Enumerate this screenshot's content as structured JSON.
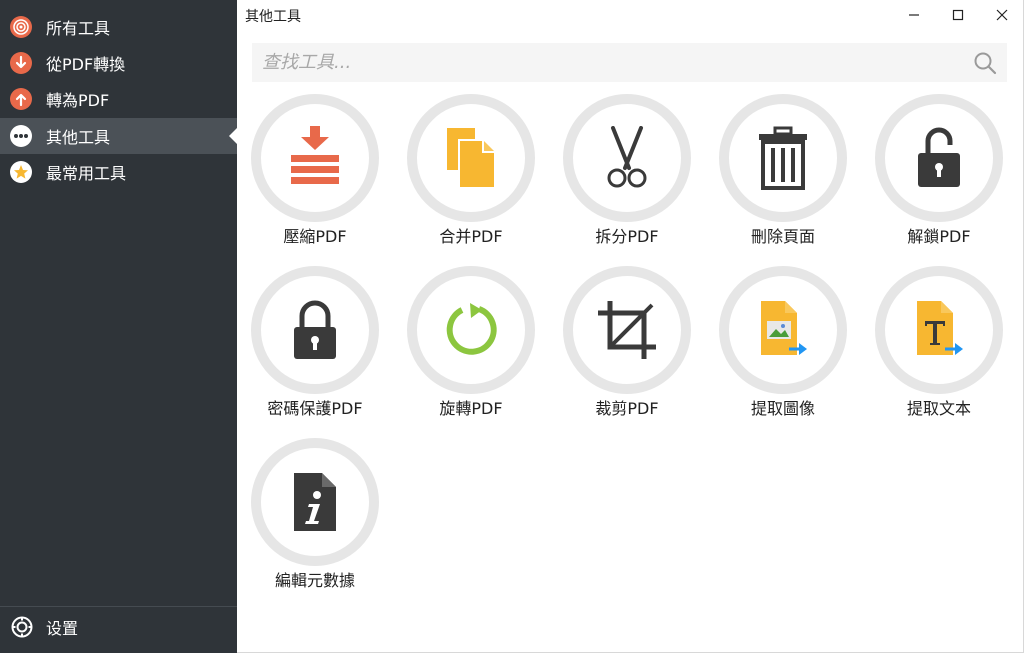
{
  "sidebar": {
    "items": [
      {
        "label": "所有工具",
        "icon": "all-tools-icon"
      },
      {
        "label": "從PDF轉換",
        "icon": "convert-from-pdf-icon"
      },
      {
        "label": "轉為PDF",
        "icon": "convert-to-pdf-icon"
      },
      {
        "label": "其他工具",
        "icon": "more-tools-icon",
        "active": true
      },
      {
        "label": "最常用工具",
        "icon": "star-icon"
      }
    ],
    "settings_label": "设置"
  },
  "window": {
    "title": "其他工具",
    "controls": [
      "minimize",
      "maximize",
      "close"
    ]
  },
  "search": {
    "placeholder": "查找工具..."
  },
  "tools": [
    {
      "label": "壓縮PDF",
      "icon": "compress-icon"
    },
    {
      "label": "合并PDF",
      "icon": "merge-icon"
    },
    {
      "label": "拆分PDF",
      "icon": "scissors-icon"
    },
    {
      "label": "刪除頁面",
      "icon": "trash-icon"
    },
    {
      "label": "解鎖PDF",
      "icon": "unlock-icon"
    },
    {
      "label": "密碼保護PDF",
      "icon": "lock-icon"
    },
    {
      "label": "旋轉PDF",
      "icon": "rotate-icon"
    },
    {
      "label": "裁剪PDF",
      "icon": "crop-icon"
    },
    {
      "label": "提取圖像",
      "icon": "extract-image-icon"
    },
    {
      "label": "提取文本",
      "icon": "extract-text-icon"
    },
    {
      "label": "編輯元數據",
      "icon": "metadata-icon"
    }
  ],
  "colors": {
    "sidebar_bg": "#2f3439",
    "sidebar_active": "#4b5157",
    "orange": "#e8694a",
    "yellow": "#f7b731",
    "green": "#8cc63f",
    "dark_icon": "#3a3a3a",
    "ring": "#e6e6e6",
    "arrow_blue": "#2196f3"
  }
}
